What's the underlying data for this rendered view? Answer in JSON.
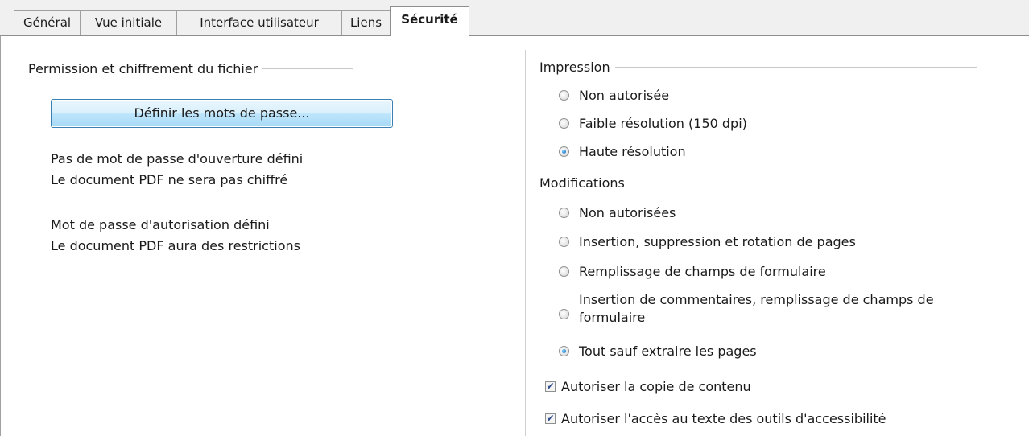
{
  "tabs": [
    {
      "label": "Général"
    },
    {
      "label": "Vue initiale"
    },
    {
      "label": "Interface utilisateur"
    },
    {
      "label": "Liens"
    },
    {
      "label": "Sécurité"
    }
  ],
  "active_tab": "Sécurité",
  "left": {
    "section_title": "Permission et chiffrement du fichier",
    "set_passwords_button": "Définir les mots de passe...",
    "open_password_status": "Pas de mot de passe d'ouverture défini",
    "encryption_status": "Le document PDF ne sera pas chiffré",
    "permission_password_status": "Mot de passe d'autorisation défini",
    "restriction_status": "Le document PDF aura des restrictions"
  },
  "printing": {
    "title": "Impression",
    "options": [
      {
        "label": "Non autorisée",
        "checked": false
      },
      {
        "label": "Faible résolution (150 dpi)",
        "checked": false
      },
      {
        "label": "Haute résolution",
        "checked": true
      }
    ]
  },
  "changes": {
    "title": "Modifications",
    "options": [
      {
        "label": "Non autorisées",
        "checked": false
      },
      {
        "label": "Insertion, suppression et rotation de pages",
        "checked": false
      },
      {
        "label": "Remplissage de champs de formulaire",
        "checked": false
      },
      {
        "label": "Insertion de commentaires, remplissage de champs de formulaire",
        "checked": false
      },
      {
        "label": "Tout sauf extraire les pages",
        "checked": true
      }
    ]
  },
  "checkboxes": [
    {
      "label": "Autoriser la copie de contenu",
      "checked": true
    },
    {
      "label": "Autoriser l'accès au texte des outils d'accessibilité",
      "checked": true
    }
  ],
  "colors": {
    "button_border": "#3c7fb1",
    "radio_dot": "#0b5bb5",
    "checkmark": "#2a4a8a"
  }
}
